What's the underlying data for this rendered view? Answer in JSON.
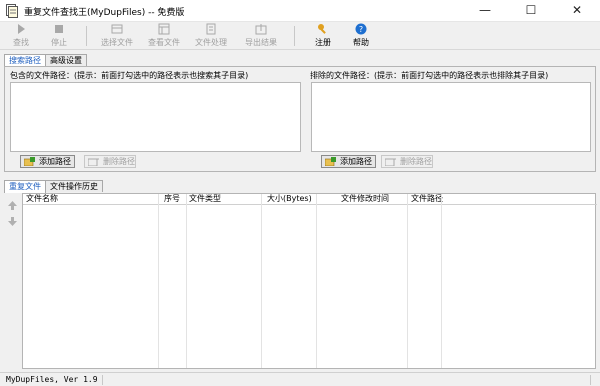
{
  "window": {
    "title": "重复文件查找王(MyDupFiles) -- 免费版",
    "minimize": "—",
    "maximize": "☐",
    "close": "✕"
  },
  "toolbar": {
    "search": "查找",
    "stop": "停止",
    "select_files": "选择文件",
    "view_file": "查看文件",
    "file_process": "文件处理",
    "export_results": "导出结果",
    "register": "注册",
    "help": "帮助"
  },
  "search_tabs": {
    "search_paths": "搜索路径",
    "advanced": "高级设置"
  },
  "include_group": {
    "label": "包含的文件路径：(提示：前面打勾选中的路径表示也搜索其子目录)",
    "add_button": "添加路径",
    "remove_button": "删除路径"
  },
  "exclude_group": {
    "label": "排除的文件路径：(提示：前面打勾选中的路径表示也排除其子目录)",
    "add_button": "添加路径",
    "remove_button": "删除路径"
  },
  "result_tabs": {
    "duplicates": "重复文件",
    "history": "文件操作历史"
  },
  "table": {
    "columns": [
      "文件名称",
      "序号",
      "文件类型",
      "大小(Bytes)",
      "文件修改时间",
      "文件路径"
    ],
    "rows": []
  },
  "status": {
    "version": "MyDupFiles, Ver 1.9"
  },
  "colors": {
    "active_tab": "#1f5fbf",
    "register_icon": "#e0a020",
    "help_icon": "#1e6fd0",
    "add_icon": "#3a9a2a"
  }
}
